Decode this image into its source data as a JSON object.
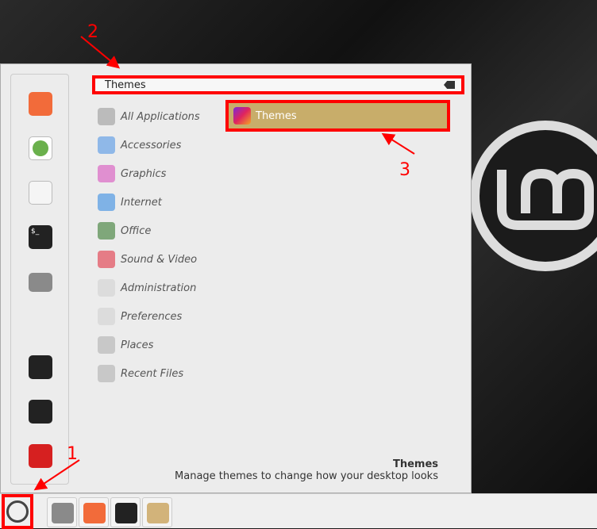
{
  "search": {
    "value": "Themes"
  },
  "categories": [
    {
      "label": "All Applications",
      "color": "#bbbbbb"
    },
    {
      "label": "Accessories",
      "color": "#8fb8e8"
    },
    {
      "label": "Graphics",
      "color": "#e08fd0"
    },
    {
      "label": "Internet",
      "color": "#7fb2e6"
    },
    {
      "label": "Office",
      "color": "#7fa77a"
    },
    {
      "label": "Sound & Video",
      "color": "#e57c86"
    },
    {
      "label": "Administration",
      "color": "#dcdcdc"
    },
    {
      "label": "Preferences",
      "color": "#dcdcdc"
    },
    {
      "label": "Places",
      "color": "#c8c8c8"
    },
    {
      "label": "Recent Files",
      "color": "#c8c8c8"
    }
  ],
  "result": {
    "label": "Themes"
  },
  "description": {
    "title": "Themes",
    "text": "Manage themes to change how your desktop looks"
  },
  "annotations": {
    "one": "1",
    "two": "2",
    "three": "3"
  }
}
